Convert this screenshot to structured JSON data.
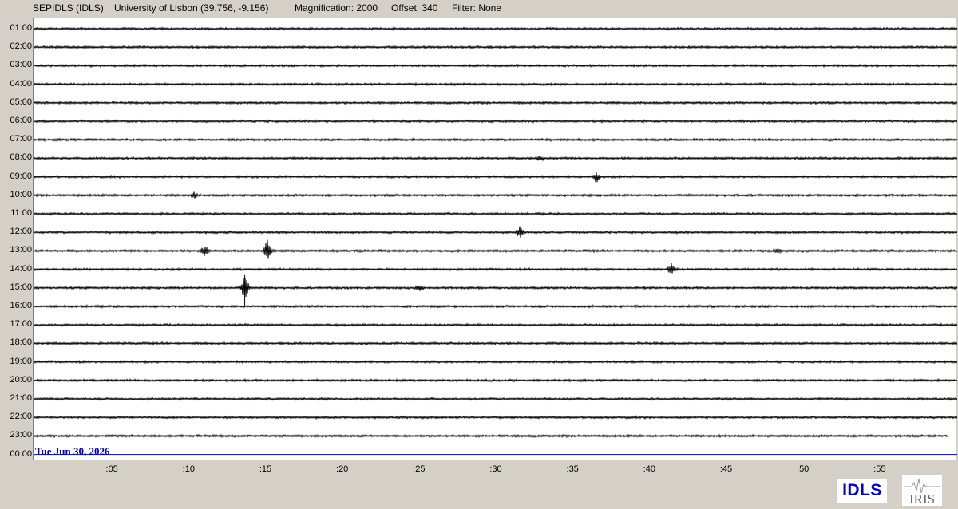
{
  "header": {
    "station": "SEPIDLS (IDLS)",
    "location": "University of Lisbon (39.756, -9.156)",
    "magnification": "Magnification: 2000",
    "offset": "Offset: 340",
    "filter": "Filter: None"
  },
  "hour_labels": [
    "01:00",
    "02:00",
    "03:00",
    "04:00",
    "05:00",
    "06:00",
    "07:00",
    "08:00",
    "09:00",
    "10:00",
    "11:00",
    "12:00",
    "13:00",
    "14:00",
    "15:00",
    "16:00",
    "17:00",
    "18:00",
    "19:00",
    "20:00",
    "21:00",
    "22:00",
    "23:00",
    "00:00"
  ],
  "minute_labels": [
    ":05",
    ":10",
    ":15",
    ":20",
    ":25",
    ":30",
    ":35",
    ":40",
    ":45",
    ":50",
    ":55"
  ],
  "date_label": "Tue Jun 30, 2026",
  "logos": {
    "idls": "IDLS",
    "iris": "IRIS"
  },
  "colors": {
    "trace": "#000000",
    "current_line": "#0000c0",
    "date_text": "#0000c0",
    "background": "#d4d0c8"
  },
  "events": [
    {
      "hour": "08:00",
      "minute": 32.8,
      "strength": 0.5
    },
    {
      "hour": "09:00",
      "minute": 36.5,
      "strength": 1.1
    },
    {
      "hour": "10:00",
      "minute": 10.3,
      "strength": 0.5
    },
    {
      "hour": "12:00",
      "minute": 31.5,
      "strength": 1.3
    },
    {
      "hour": "13:00",
      "minute": 11.0,
      "strength": 1.2
    },
    {
      "hour": "13:00",
      "minute": 15.1,
      "strength": 2.4
    },
    {
      "hour": "13:00",
      "minute": 48.3,
      "strength": 0.6
    },
    {
      "hour": "14:00",
      "minute": 41.4,
      "strength": 1.3
    },
    {
      "hour": "15:00",
      "minute": 13.6,
      "strength": 2.8
    },
    {
      "hour": "15:00",
      "minute": 25.0,
      "strength": 0.5
    }
  ]
}
